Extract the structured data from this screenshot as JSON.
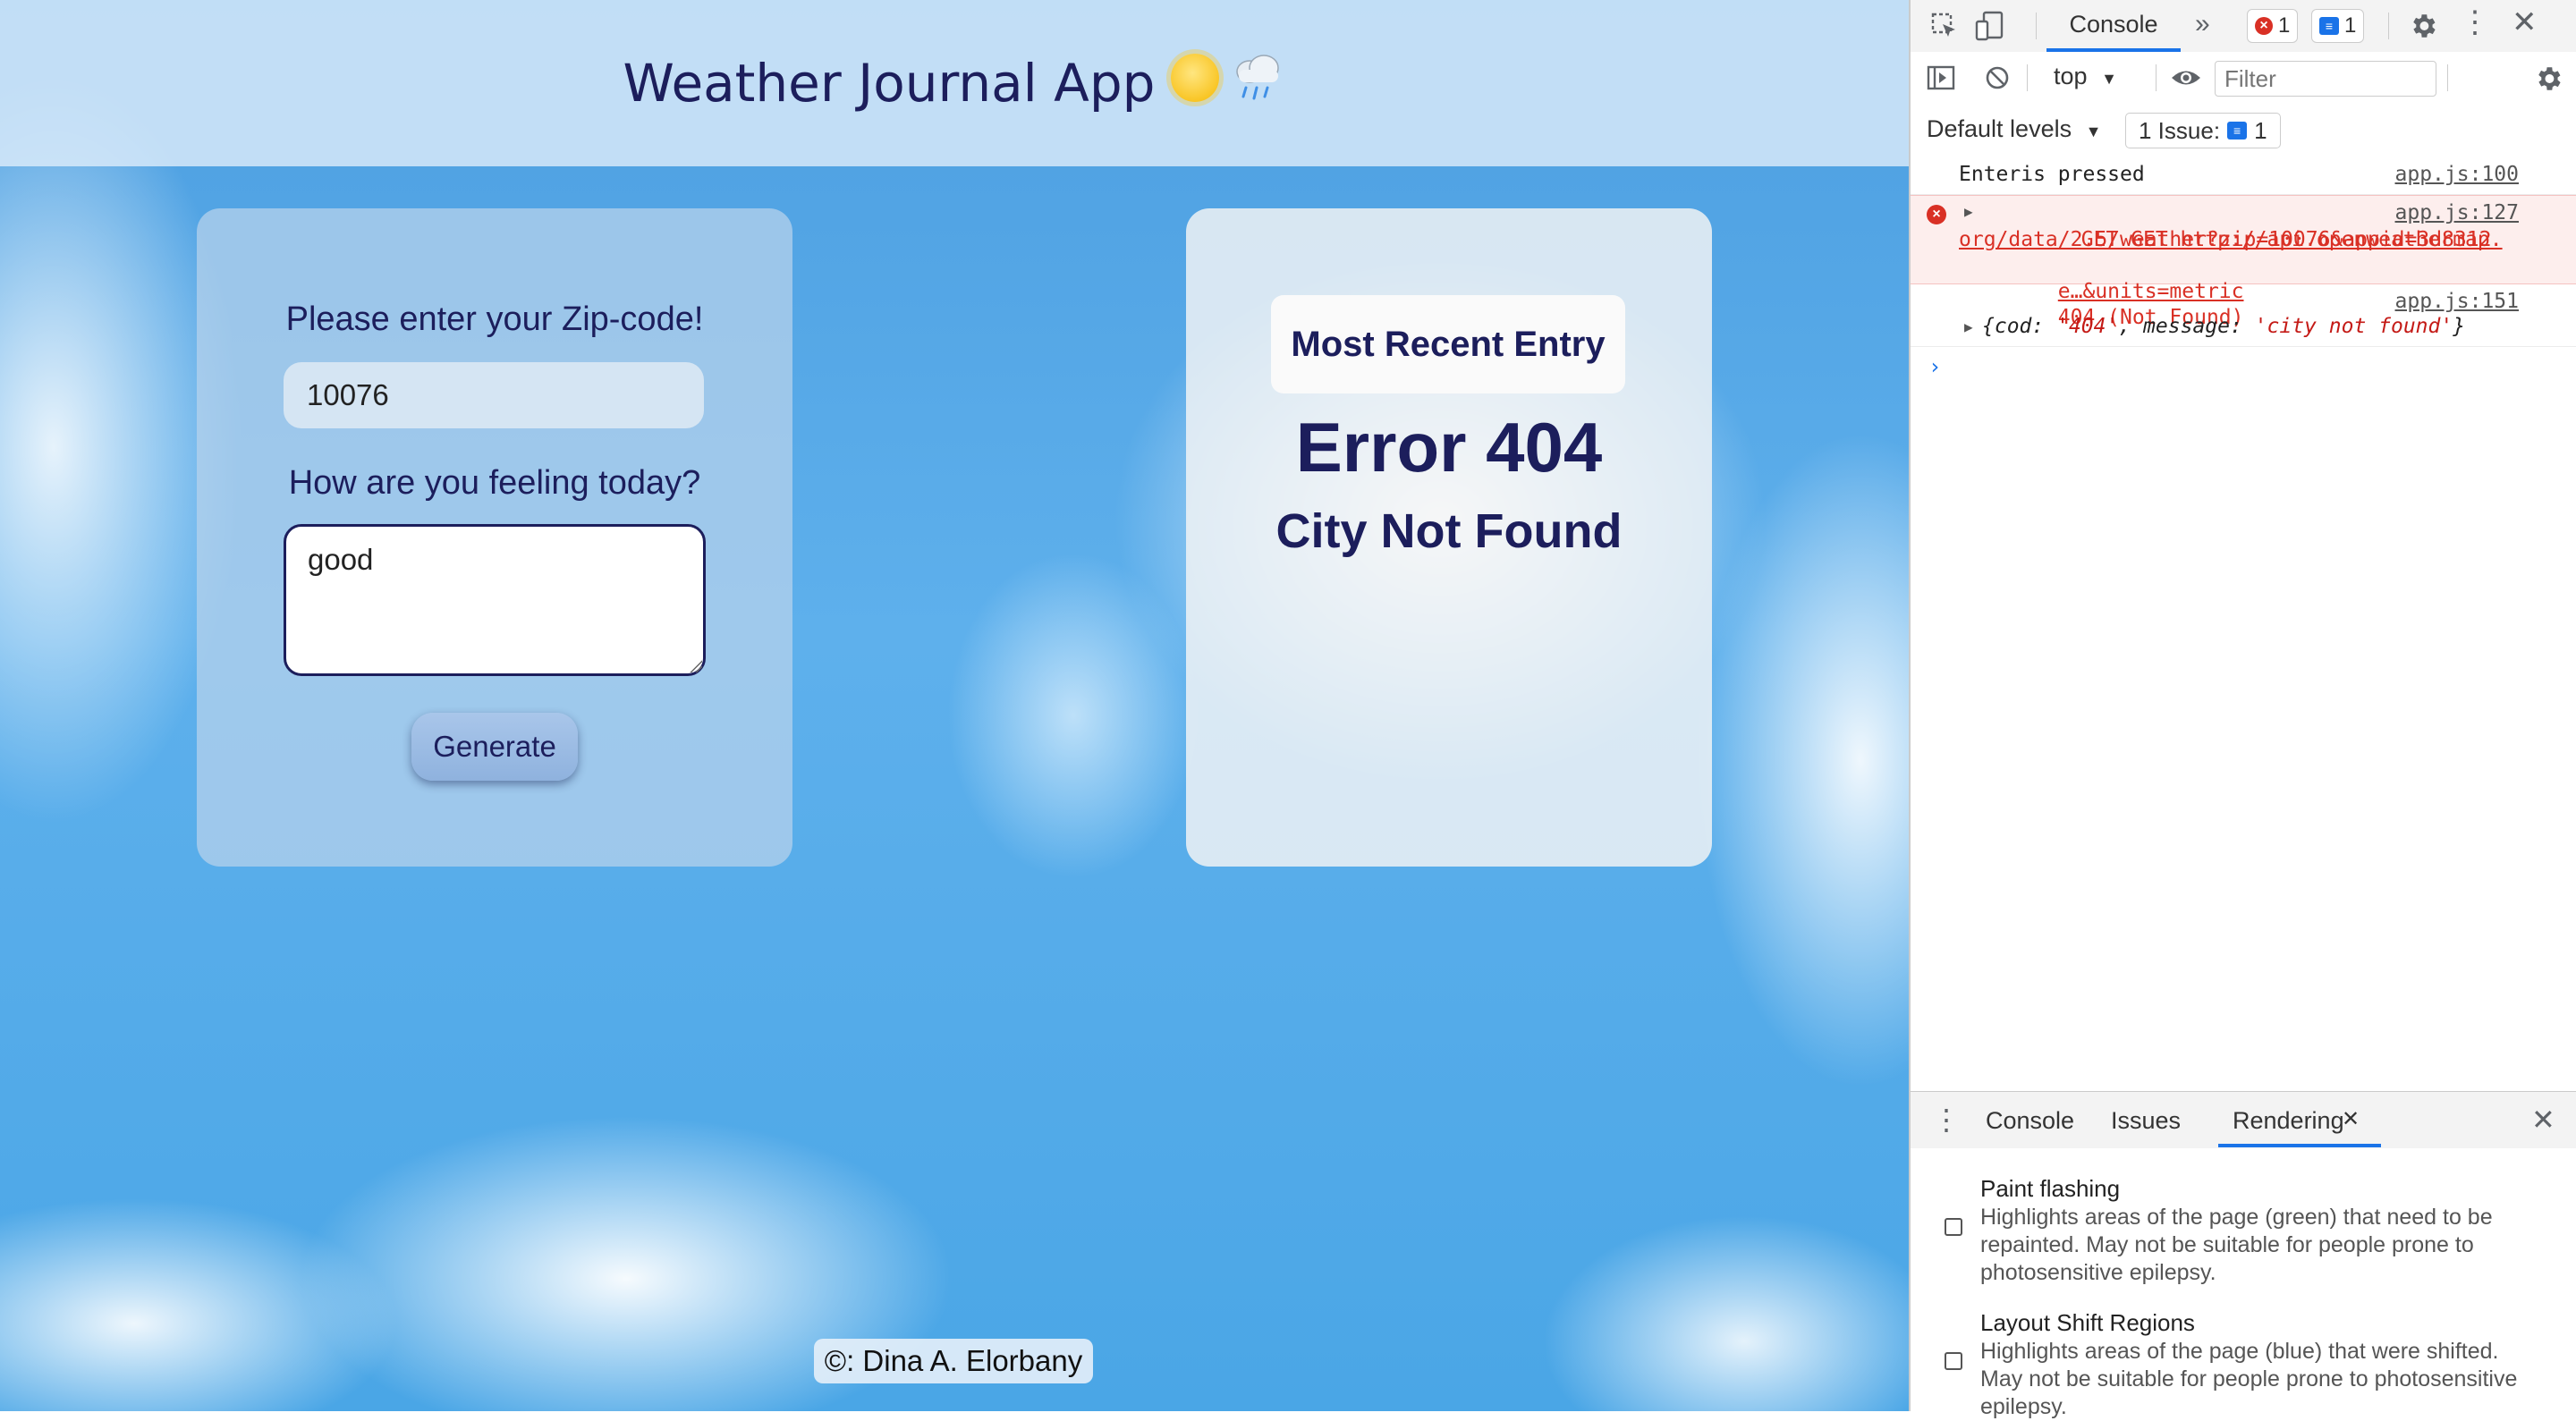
{
  "app": {
    "title": "Weather Journal App",
    "sun_emoji": "sun-with-face-icon",
    "cloud_emoji": "cloud-with-rain-icon"
  },
  "form": {
    "zip_label": "Please enter your Zip-code!",
    "zip_value": "10076",
    "feelings_label": "How are you feeling today?",
    "feelings_value": "good",
    "generate_label": "Generate"
  },
  "entry": {
    "heading": "Most Recent Entry",
    "error_code": "Error 404",
    "error_message": "City Not Found"
  },
  "footer": {
    "text": "©: Dina A. Elorbany"
  },
  "devtools": {
    "active_tab": "Console",
    "error_count": "1",
    "message_count": "1",
    "context": "top",
    "filter_placeholder": "Filter",
    "levels": "Default levels",
    "issues_label": "1 Issue:",
    "issues_count": "1",
    "logs": [
      {
        "text": "Enteris pressed",
        "source": "app.js:100"
      },
      {
        "text_line1": "GET http://api.openweathermap.",
        "text_line2": "org/data/2.5/weather?zip=10076&appid=3d8312",
        "text_line3": "e…&units=metric",
        "status": "404 (Not Found)",
        "source": "app.js:127"
      },
      {
        "object_prefix": "{cod: ",
        "cod": "'404'",
        "object_sep": ", message: ",
        "message": "'city not found'",
        "object_suffix": "}",
        "source": "app.js:151"
      }
    ],
    "drawer_tabs": [
      "Console",
      "Issues",
      "Rendering"
    ],
    "rendering_options": [
      {
        "title": "Paint flashing",
        "desc": "Highlights areas of the page (green) that need to be repainted. May not be suitable for people prone to photosensitive epilepsy."
      },
      {
        "title": "Layout Shift Regions",
        "desc": "Highlights areas of the page (blue) that were shifted. May not be suitable for people prone to photosensitive epilepsy."
      }
    ],
    "colors": {
      "accent": "#1a73e8",
      "error": "#d93025",
      "error_bg": "#fdeeed"
    }
  }
}
